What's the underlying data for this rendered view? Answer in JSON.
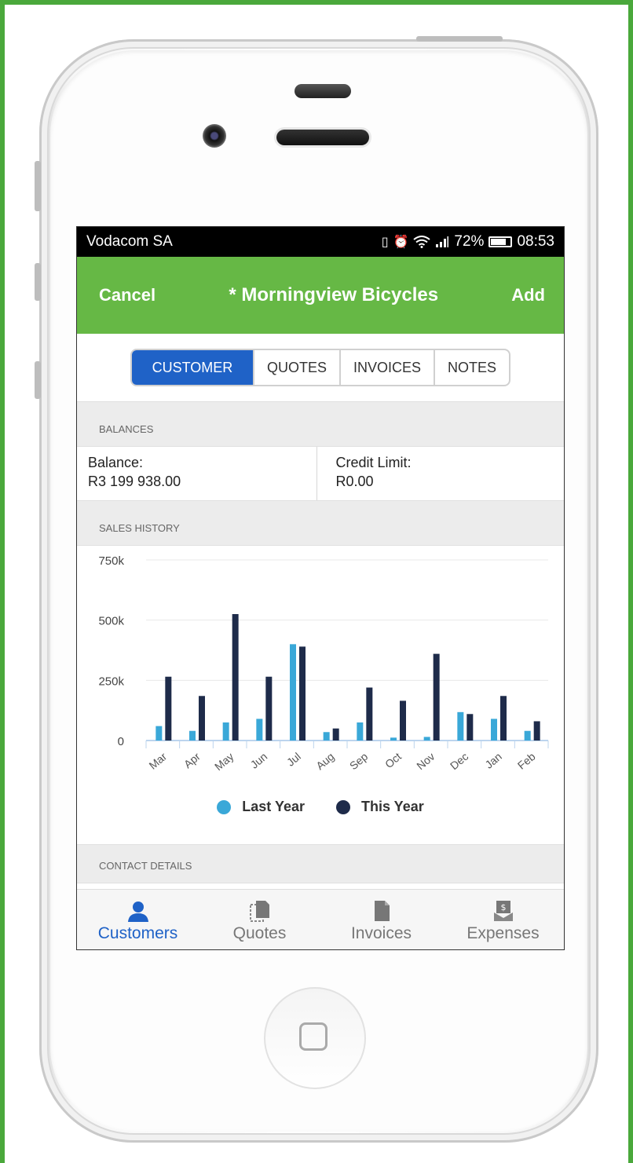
{
  "status_bar": {
    "carrier": "Vodacom SA",
    "icons": [
      "vibrate-icon",
      "alarm-icon",
      "wifi-icon",
      "signal-icon"
    ],
    "battery": "72%",
    "time": "08:53"
  },
  "app_bar": {
    "cancel": "Cancel",
    "title": "* Morningview Bicycles",
    "add": "Add",
    "color": "#66b845"
  },
  "segments": [
    "CUSTOMER",
    "QUOTES",
    "INVOICES",
    "NOTES"
  ],
  "active_segment": "CUSTOMER",
  "balances": {
    "header": "BALANCES",
    "balance_label": "Balance:",
    "balance_value": "R3 199 938.00",
    "credit_label": "Credit Limit:",
    "credit_value": "R0.00"
  },
  "sales_history": {
    "header": "SALES HISTORY"
  },
  "chart_data": {
    "type": "bar",
    "categories": [
      "Mar",
      "Apr",
      "May",
      "Jun",
      "Jul",
      "Aug",
      "Sep",
      "Oct",
      "Nov",
      "Dec",
      "Jan",
      "Feb"
    ],
    "series": [
      {
        "name": "Last Year",
        "color": "#3aa8d8",
        "values": [
          60,
          40,
          75,
          90,
          400,
          35,
          75,
          12,
          15,
          118,
          90,
          40
        ]
      },
      {
        "name": "This Year",
        "color": "#1e2b4a",
        "values": [
          265,
          185,
          525,
          265,
          390,
          50,
          220,
          165,
          360,
          110,
          185,
          80
        ]
      }
    ],
    "yticks": [
      "0",
      "250k",
      "500k",
      "750k"
    ],
    "ylim": [
      0,
      750
    ],
    "grid": true,
    "legend": "bottom"
  },
  "contact_details": {
    "header": "CONTACT DETAILS"
  },
  "tabs": [
    {
      "label": "Customers",
      "icon": "person-icon",
      "active": true
    },
    {
      "label": "Quotes",
      "icon": "quote-doc-icon",
      "active": false
    },
    {
      "label": "Invoices",
      "icon": "invoice-doc-icon",
      "active": false
    },
    {
      "label": "Expenses",
      "icon": "expense-doc-icon",
      "active": false
    }
  ]
}
